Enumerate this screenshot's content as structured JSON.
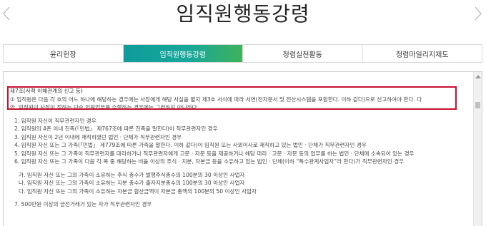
{
  "page": {
    "title": "임직원행동강령"
  },
  "tabs": [
    {
      "label": "윤리헌장"
    },
    {
      "label": "임직원행동강령"
    },
    {
      "label": "청렴실천활동"
    },
    {
      "label": "청렴마일리지제도"
    }
  ],
  "colors": {
    "active_tab_start": "#0f9c9a",
    "active_tab_end": "#3fb25b",
    "highlight_border": "#c8102e"
  },
  "icons": {
    "prev": "chevron-left-icon",
    "next": "chevron-right-icon"
  },
  "article": {
    "heading": "제7조(사적 이해관계의 신고 등)",
    "para1_line1": "① 임직원은 다음 각 호의 어느 하나에 해당하는 경우에는 사장에게 해당 사실을 별지 제3호 서식에 따라 서면(전자문서 및 전산시스템을 포함한다. 이하 같다)으로 신고하여야 한다. 다",
    "para1_line2": "만, 임직원이 사장이 정하는 단순 민원업무를 수행하는 경우에는 그러하지 아니하다.",
    "items": [
      "1. 임직원 자신이 직무관련자인 경우",
      "2. 임직원의 4촌 이내 친족(「민법」 제767조에 따른 친족을 말한다)이 직무관련자인 경우",
      "3. 임직원 자신이 2년 이내에 재직하였던 법인 · 단체가 직무관련자인 경우",
      "4. 임직원 자신 또는 그 가족(「민법」 제779조에 따른 가족을 말한다. 이하 같다)이 임직원 또는 사외이사로 재직하고 있는 법인 · 단체가 직무관련자인 경우",
      "5. 임직원 자신 또는 그 가족이 직무관련자를 대리하거나 직무관련자에게 고문 · 자문 등을 제공하거나 해당 대리 · 고문 · 자문 등의 업무를 하는 법인 · 단체에 소속되어 있는 경우",
      "6. 임직원 자신 또는 그 가족이 다음 각 목 중 해당하는 비율 이상의 주식 · 지분, 자본금 등을 소유하고 있는 법인 · 단체(이하 “특수관계사업자”라 한다)가 직무관련자인 경우"
    ],
    "subitems": [
      "가. 임직원 자신 또는 그의 가족이 소유하는 주식 총수가 발행주식총수의 100분의 30 이상인 사업자",
      "나. 임직원 자신 또는 그의 가족이 소유하는 지분 총수가 출자지분총수의 100분의 30 이상인 사업자",
      "다. 임직원 자신 또는 그의 가족이 소유하는 자본금 합산금액이 자본금 총액의 100분의 50 이상인 사업자"
    ],
    "item7": "7. 500만원 이상의 금전거래가 있는 자가 직무관련자인 경우"
  }
}
